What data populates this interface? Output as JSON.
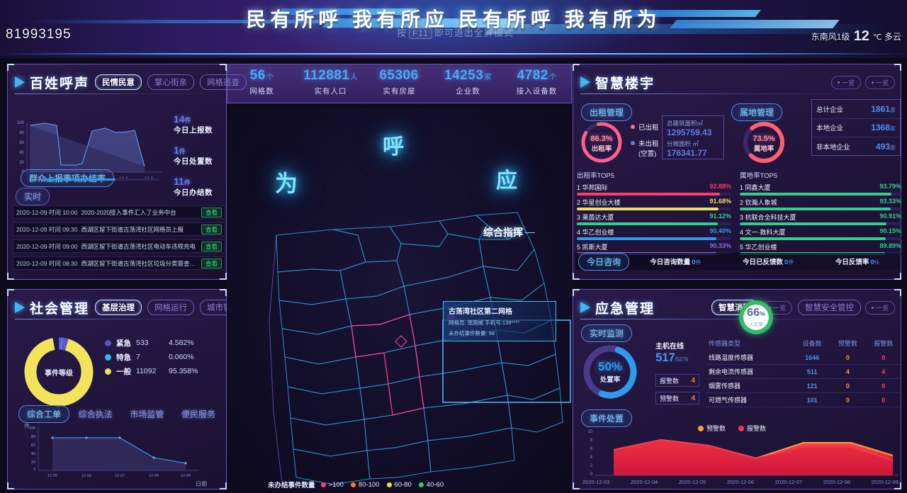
{
  "header": {
    "id": "81993195",
    "title": "民有所呼   我有所应   民有所呼   我有所为",
    "esc_prefix": "按",
    "esc_key": "F11",
    "esc_suffix": "即可退出全屏模式",
    "weather_wind": "东南风1级",
    "weather_temp": "12",
    "weather_unit": "℃",
    "weather_desc": "多云"
  },
  "stats_bar": [
    {
      "value": "56",
      "unit": "个",
      "label": "网格数"
    },
    {
      "value": "112881",
      "unit": "人",
      "label": "实有人口"
    },
    {
      "value": "65306",
      "unit": "",
      "label": "实有房屋"
    },
    {
      "value": "14253",
      "unit": "家",
      "label": "企业数"
    },
    {
      "value": "4782",
      "unit": "个",
      "label": "接入设备数"
    }
  ],
  "voice_panel": {
    "title": "百姓呼声",
    "tabs": [
      {
        "label": "民情民意",
        "active": true
      },
      {
        "label": "掌心街亲",
        "active": false
      },
      {
        "label": "网格巡查",
        "active": false
      }
    ],
    "chip": "群众上报事项办结率",
    "realtime_chip": "实时",
    "stats": [
      {
        "value": "14",
        "unit": "件",
        "label": "今日上报数"
      },
      {
        "value": "1",
        "unit": "件",
        "label": "今日处置数"
      },
      {
        "value": "11",
        "unit": "件",
        "label": "今日办结数"
      }
    ],
    "chart": {
      "x_ticks": [
        "11-29",
        "11-30",
        "12-1",
        "12-2",
        "12-3"
      ],
      "y_ticks": [
        "100",
        "80",
        "60",
        "40",
        "20",
        "0"
      ],
      "values": [
        88,
        92,
        8,
        8,
        78,
        92,
        85,
        86,
        87,
        10
      ]
    },
    "feed": [
      {
        "time": "2020-12-09  时间 10:00",
        "text": "2020-2020接入事件汇入了业务中台",
        "btn": "查看"
      },
      {
        "time": "2020-12-09  时间 09:30",
        "text": "西湖区留下街道古荡湾社区网格员上报",
        "btn": "查看"
      },
      {
        "time": "2020-12-09  时间 09:00",
        "text": "西湖区留下街道古荡湾社区电动车违规充电",
        "btn": "查看"
      },
      {
        "time": "2020-12-09  时间 08:30",
        "text": "西湖区留下街道古荡湾社区垃圾分类督查通告",
        "btn": "查看"
      }
    ]
  },
  "society_panel": {
    "title": "社会管理",
    "tabs": [
      {
        "label": "基层治理",
        "active": true
      },
      {
        "label": "网格运行",
        "active": false
      },
      {
        "label": "城市管理",
        "active": false
      }
    ],
    "donut_label": "事件等级",
    "legend": [
      {
        "name": "紧急",
        "count": "533",
        "pct": "4.582%",
        "color": "#5f55c8"
      },
      {
        "name": "特急",
        "count": "7",
        "pct": "0.060%",
        "color": "#35b8ee"
      },
      {
        "name": "一般",
        "count": "11092",
        "pct": "95.358%",
        "color": "#f2e35a"
      }
    ],
    "tabs4": [
      {
        "label": "综合工单",
        "active": true
      },
      {
        "label": "综合执法",
        "active": false
      },
      {
        "label": "市场监管",
        "active": false
      },
      {
        "label": "便民服务",
        "active": false
      }
    ],
    "chart": {
      "y_axis_label": "件",
      "x_axis_label": "日期",
      "x_ticks": [
        "12-05",
        "12-06",
        "12-07",
        "12-08",
        "12-09"
      ],
      "values": [
        72,
        71,
        70,
        30,
        18
      ]
    }
  },
  "map_panel": {
    "glow_words": [
      "为",
      "呼",
      "应"
    ],
    "command_label": "综合指挥",
    "tooltip": {
      "title": "古荡湾社区第二网格",
      "row1": "网格员:  张国威   手机号:139****",
      "row2": "未办结事件数量:  98"
    },
    "legend_label": "未办结事件数量",
    "legend_items": [
      {
        "label": ">100",
        "color": "#ff3c78"
      },
      {
        "label": "80-100",
        "color": "#ff7a28"
      },
      {
        "label": "60-80",
        "color": "#f0e040"
      },
      {
        "label": "40-60",
        "color": "#30d06a"
      }
    ]
  },
  "building_panel": {
    "title": "智慧楼宇",
    "mini_pills": [
      "一览",
      "一览"
    ],
    "rent_chip": "出租管理",
    "local_chip": "属地管理",
    "rent_gauge": {
      "pct": "86.3%",
      "label": "出租率"
    },
    "rent_legend": [
      {
        "label": "已出租",
        "color": "#ff6e8e"
      },
      {
        "label": "未出租\n(空置)",
        "color": "#7a6cd8"
      }
    ],
    "rent_info": [
      {
        "k": "总建筑面积㎡",
        "v": "1295759.43"
      },
      {
        "k": "分摊面积 ㎡",
        "v": "176341.77"
      }
    ],
    "local_gauge": {
      "pct": "73.5%",
      "label": "属地率"
    },
    "enterprise": [
      {
        "k": "总计企业",
        "v": "1861",
        "u": "家"
      },
      {
        "k": "本地企业",
        "v": "1368",
        "u": "家"
      },
      {
        "k": "非本地企业",
        "v": "493",
        "u": "家"
      }
    ],
    "rent_top_title": "出租率TOP5",
    "rent_top": [
      {
        "name": "1 华邦国际",
        "pct": "92.88%",
        "color": "#ff3c6e"
      },
      {
        "name": "2 华星创业大楼",
        "pct": "91.68%",
        "color": "#eee25a"
      },
      {
        "name": "3 莱茵达大厦",
        "pct": "91.12%",
        "color": "#2fd08a"
      },
      {
        "name": "4 华乙创业楼",
        "pct": "90.40%",
        "color": "#2f9ae8"
      },
      {
        "name": "5 凯斯大厦",
        "pct": "90.33%",
        "color": "#8f6ae0"
      }
    ],
    "local_top_title": "属地率TOP5",
    "local_top": [
      {
        "name": "1 同鑫大厦",
        "pct": "93.79%",
        "color": "#2fd08a"
      },
      {
        "name": "2 钦瀚人象城",
        "pct": "93.33%",
        "color": "#2fd08a"
      },
      {
        "name": "3 杭联合全科技大厦",
        "pct": "90.91%",
        "color": "#2fd08a"
      },
      {
        "name": "4 文一·数科大厦",
        "pct": "90.15%",
        "color": "#2fd08a"
      },
      {
        "name": "5 华乙创业楼",
        "pct": "89.89%",
        "color": "#2fd08a"
      }
    ],
    "status_chip": "今日咨询",
    "status_items": [
      {
        "k": "今日咨询数量",
        "v": "0",
        "u": "件"
      },
      {
        "k": "今日已反馈数",
        "v": "0",
        "u": "件"
      },
      {
        "k": "今日反馈率",
        "v": "0",
        "u": "%"
      }
    ]
  },
  "emergency_panel": {
    "title": "应急管理",
    "tabs": [
      {
        "label": "智慧消防",
        "active": true
      },
      {
        "label": "智慧安全管控",
        "active": false
      }
    ],
    "mini_pills": [
      "一览",
      "一览"
    ],
    "badge": {
      "value": "66",
      "pct": "%",
      "sub": "火灾率"
    },
    "monitor_chip": "实时监测",
    "handle_chip": "事件处置",
    "gauge": {
      "pct": "50%",
      "label": "处置率"
    },
    "host": {
      "label": "主机在线",
      "value": "517",
      "unit": "/5276"
    },
    "kv": [
      {
        "k": "报警数",
        "v": "4"
      },
      {
        "k": "预警数",
        "v": "4"
      }
    ],
    "table": {
      "headers": [
        "传感器类型",
        "设备数",
        "预警数",
        "报警数"
      ],
      "rows": [
        [
          "线路温度传感器",
          "1646",
          "0",
          "0"
        ],
        [
          "剩余电流传感器",
          "511",
          "4",
          "4"
        ],
        [
          "烟雾传感器",
          "121",
          "0",
          "0"
        ],
        [
          "可燃气传感器",
          "101",
          "0",
          "0"
        ]
      ]
    },
    "chart": {
      "legend": [
        {
          "label": "预警数",
          "color": "#ff9a3c"
        },
        {
          "label": "报警数",
          "color": "#ff2f5e"
        }
      ],
      "x_ticks": [
        "2020-12-03",
        "2020-12-04",
        "2020-12-05",
        "2020-12-06",
        "2020-12-07",
        "2020-12-08",
        "2020-12-09"
      ],
      "y_ticks": [
        "10",
        "8",
        "6",
        "4",
        "2",
        "0"
      ],
      "series": [
        {
          "name": "预警数",
          "values": [
            6,
            7.2,
            6.4,
            4,
            6.6,
            6.6,
            4.2
          ]
        },
        {
          "name": "报警数",
          "values": [
            6,
            7.2,
            6.4,
            4,
            6.2,
            6.2,
            3.6
          ]
        }
      ]
    }
  }
}
